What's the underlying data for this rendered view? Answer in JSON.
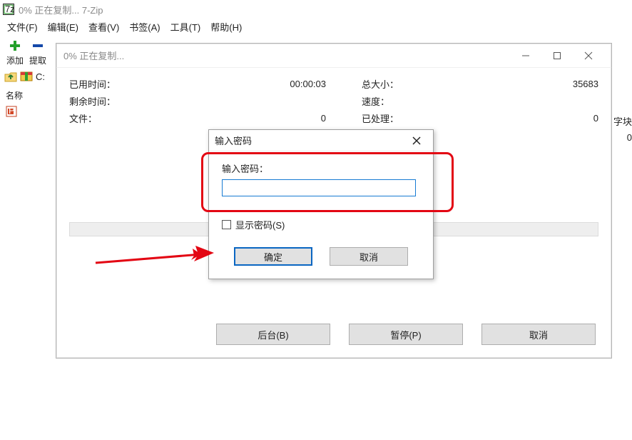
{
  "titlebar": {
    "text": "0% 正在复制... 7-Zip"
  },
  "menu": {
    "file": "文件(F)",
    "edit": "编辑(E)",
    "view": "查看(V)",
    "bookmark": "书签(A)",
    "tools": "工具(T)",
    "help": "帮助(H)"
  },
  "toolbar": {
    "add": "添加",
    "extract": "提取"
  },
  "path_prefix": "C:",
  "columns": {
    "name": "名称"
  },
  "right_partial": {
    "col": "字块",
    "val": "0"
  },
  "progress": {
    "title": "0% 正在复制...",
    "labels": {
      "elapsed": "已用时间：",
      "remaining": "剩余时间：",
      "files": "文件：",
      "totalSize": "总大小：",
      "speed": "速度：",
      "processed": "已处理："
    },
    "values": {
      "elapsed": "00:00:03",
      "files": "0",
      "totalSize": "35683",
      "processed": "0"
    },
    "buttons": {
      "background": "后台(B)",
      "pause": "暂停(P)",
      "cancel": "取消"
    }
  },
  "password": {
    "title": "输入密码",
    "label": "输入密码：",
    "value": "",
    "showPw": "显示密码(S)",
    "ok": "确定",
    "cancel": "取消"
  }
}
